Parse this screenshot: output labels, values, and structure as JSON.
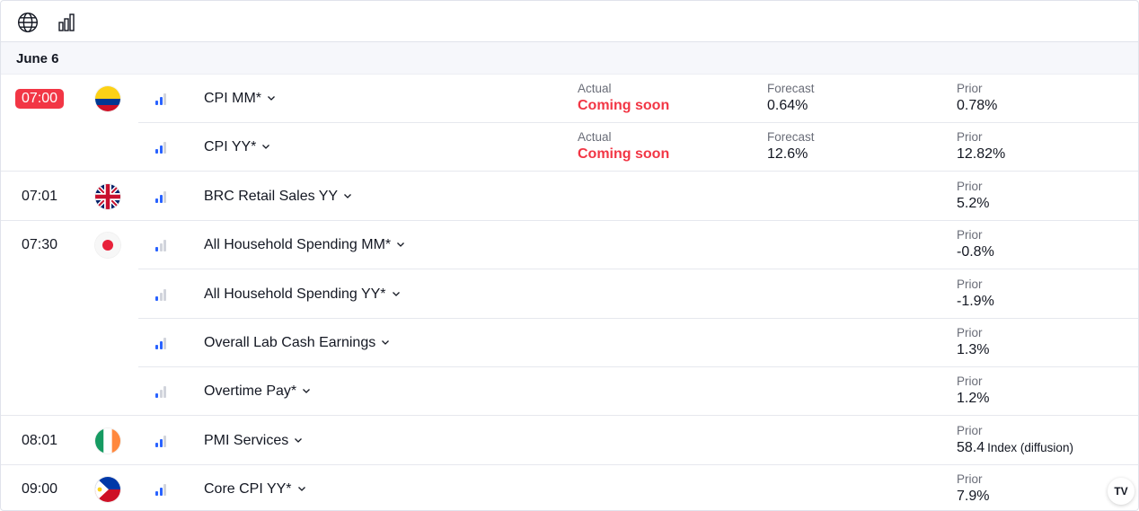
{
  "toolbar": {
    "icons": [
      "globe-icon",
      "bar-chart-icon"
    ]
  },
  "date_header": "June 6",
  "labels": {
    "actual": "Actual",
    "forecast": "Forecast",
    "prior": "Prior"
  },
  "colors": {
    "accent_red": "#f23645",
    "importance_on": "#2962ff",
    "importance_off": "#d1d4dc"
  },
  "rows": [
    {
      "time": "07:00",
      "live": true,
      "flag": "colombia",
      "importance": 2,
      "event": "CPI MM*",
      "actual": "Coming soon",
      "forecast": "0.64%",
      "prior": "0.78%"
    },
    {
      "time": "",
      "live": false,
      "flag": "",
      "importance": 2,
      "event": "CPI YY*",
      "actual": "Coming soon",
      "forecast": "12.6%",
      "prior": "12.82%"
    },
    {
      "time": "07:01",
      "live": false,
      "flag": "united-kingdom",
      "importance": 2,
      "event": "BRC Retail Sales YY",
      "prior": "5.2%"
    },
    {
      "time": "07:30",
      "live": false,
      "flag": "japan",
      "importance": 1,
      "event": "All Household Spending MM*",
      "prior": "-0.8%"
    },
    {
      "time": "",
      "live": false,
      "flag": "",
      "importance": 1,
      "event": "All Household Spending YY*",
      "prior": "-1.9%"
    },
    {
      "time": "",
      "live": false,
      "flag": "",
      "importance": 2,
      "event": "Overall Lab Cash Earnings",
      "prior": "1.3%"
    },
    {
      "time": "",
      "live": false,
      "flag": "",
      "importance": 1,
      "event": "Overtime Pay*",
      "prior": "1.2%"
    },
    {
      "time": "08:01",
      "live": false,
      "flag": "ireland",
      "importance": 2,
      "event": "PMI Services",
      "prior": "58.4",
      "prior_unit": "Index (diffusion)"
    },
    {
      "time": "09:00",
      "live": false,
      "flag": "philippines",
      "importance": 2,
      "event": "Core CPI YY*",
      "prior": "7.9%"
    }
  ],
  "brand_badge": "TV"
}
